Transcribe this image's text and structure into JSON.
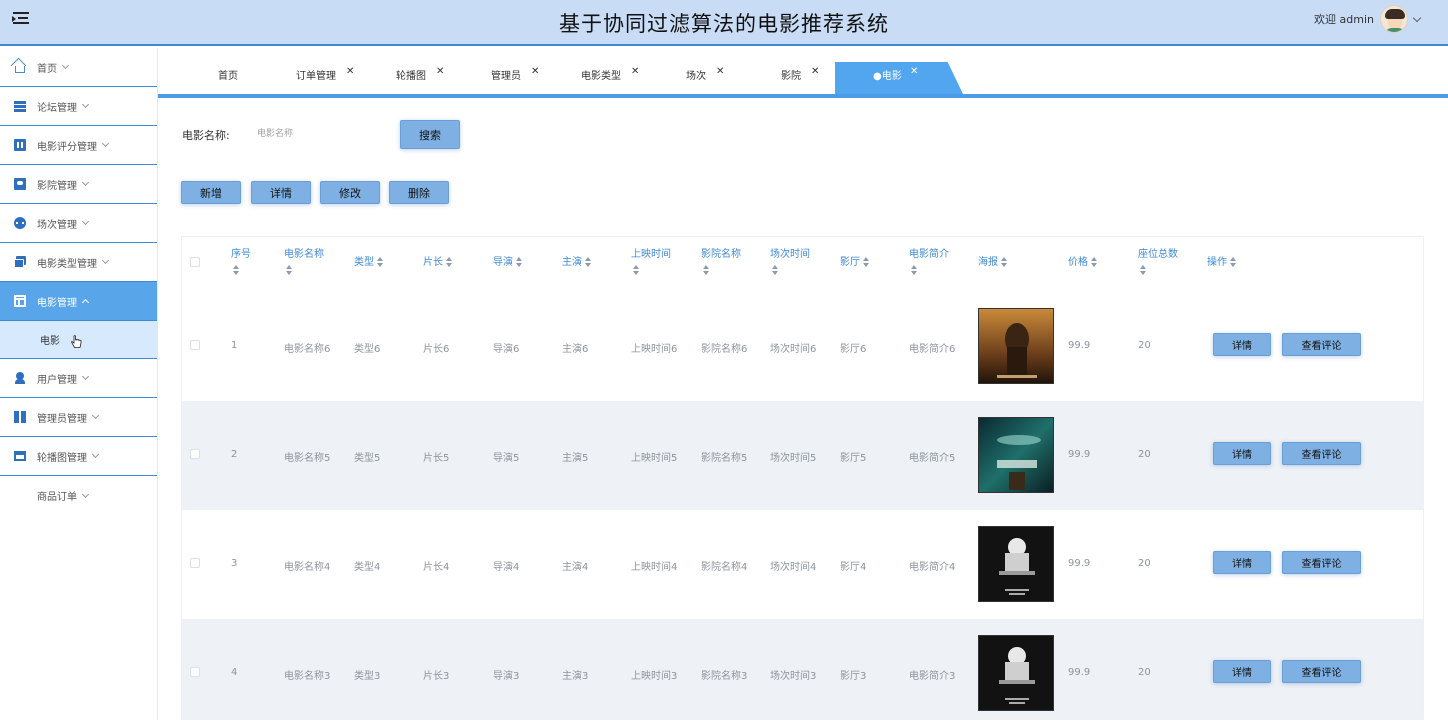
{
  "header": {
    "title": "基于协同过滤算法的电影推荐系统",
    "welcome": "欢迎 admin"
  },
  "sidebar": {
    "items": [
      {
        "label": "首页",
        "icon": "home-icon"
      },
      {
        "label": "论坛管理",
        "icon": "forum-icon"
      },
      {
        "label": "电影评分管理",
        "icon": "rating-icon"
      },
      {
        "label": "影院管理",
        "icon": "cinema-icon"
      },
      {
        "label": "场次管理",
        "icon": "schedule-icon"
      },
      {
        "label": "电影类型管理",
        "icon": "folder-icon"
      },
      {
        "label": "电影管理",
        "icon": "layout-icon",
        "active": true,
        "sub": [
          "电影"
        ]
      },
      {
        "label": "用户管理",
        "icon": "user-icon"
      },
      {
        "label": "管理员管理",
        "icon": "admin-icon"
      },
      {
        "label": "轮播图管理",
        "icon": "carousel-icon"
      },
      {
        "label": "商品订单",
        "icon": ""
      }
    ]
  },
  "tabs": [
    {
      "label": "首页",
      "closable": false
    },
    {
      "label": "订单管理",
      "closable": true
    },
    {
      "label": "轮播图",
      "closable": true
    },
    {
      "label": "管理员",
      "closable": true
    },
    {
      "label": "电影类型",
      "closable": true
    },
    {
      "label": "场次",
      "closable": true
    },
    {
      "label": "影院",
      "closable": true
    },
    {
      "label": "●电影",
      "closable": true,
      "active": true
    }
  ],
  "search": {
    "label": "电影名称:",
    "placeholder": "电影名称",
    "button": "搜索"
  },
  "actions": {
    "add": "新增",
    "detail": "详情",
    "edit": "修改",
    "delete": "删除"
  },
  "table": {
    "columns": [
      "序号",
      "电影名称",
      "类型",
      "片长",
      "导演",
      "主演",
      "上映时间",
      "影院名称",
      "场次时间",
      "影厅",
      "电影简介",
      "海报",
      "价格",
      "座位总数",
      "操作"
    ],
    "row_buttons": {
      "detail": "详情",
      "comments": "查看评论"
    },
    "rows": [
      {
        "cells": [
          "1",
          "电影名称6",
          "类型6",
          "片长6",
          "导演6",
          "主演6",
          "上映时间6",
          "影院名称6",
          "场次时间6",
          "影厅6",
          "电影简介6",
          "99.9",
          "20"
        ],
        "poster": "desert"
      },
      {
        "cells": [
          "2",
          "电影名称5",
          "类型5",
          "片长5",
          "导演5",
          "主演5",
          "上映时间5",
          "影院名称5",
          "场次时间5",
          "影厅5",
          "电影简介5",
          "99.9",
          "20"
        ],
        "poster": "space"
      },
      {
        "cells": [
          "3",
          "电影名称4",
          "类型4",
          "片长4",
          "导演4",
          "主演4",
          "上映时间4",
          "影院名称4",
          "场次时间4",
          "影厅4",
          "电影简介4",
          "99.9",
          "20"
        ],
        "poster": "dark"
      },
      {
        "cells": [
          "4",
          "电影名称3",
          "类型3",
          "片长3",
          "导演3",
          "主演3",
          "上映时间3",
          "影院名称3",
          "场次时间3",
          "影厅3",
          "电影简介3",
          "99.9",
          "20"
        ],
        "poster": "dark"
      }
    ]
  },
  "colors": {
    "accent": "#52a6ef",
    "header_bg": "#c8dcf6",
    "button": "#7eb0e4",
    "sidebar_active": "#58a5ea"
  }
}
